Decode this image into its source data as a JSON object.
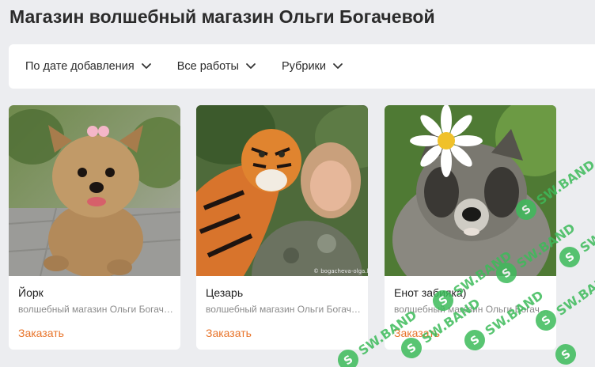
{
  "page": {
    "title": "Магазин волшебный магазин Ольги Богачевой"
  },
  "filters": [
    {
      "label": "По дате добавления",
      "icon": "chevron-down-icon"
    },
    {
      "label": "Все работы",
      "icon": "chevron-down-icon"
    },
    {
      "label": "Рубрики",
      "icon": "chevron-down-icon"
    }
  ],
  "cards": [
    {
      "title": "Йорк",
      "shop": "волшебный магазин Ольги Богачевой",
      "order_label": "Заказать",
      "image": "yorkshire-terrier-toy-photo"
    },
    {
      "title": "Цезарь",
      "shop": "волшебный магазин Ольги Богачевой",
      "order_label": "Заказать",
      "image": "tiger-toy-with-woman-photo",
      "photo_caption": "© bogacheva-olga.livemaster"
    },
    {
      "title": "Енот забияка)",
      "shop": "волшебный магазин Ольги Богачевой",
      "order_label": "Заказать",
      "image": "raccoon-toy-with-daisy-photo"
    }
  ],
  "watermark": {
    "text": "SW.BAND",
    "color": "#3dbb5a"
  },
  "colors": {
    "accent": "#e8742a",
    "background": "#ecedf0",
    "card": "#ffffff"
  }
}
